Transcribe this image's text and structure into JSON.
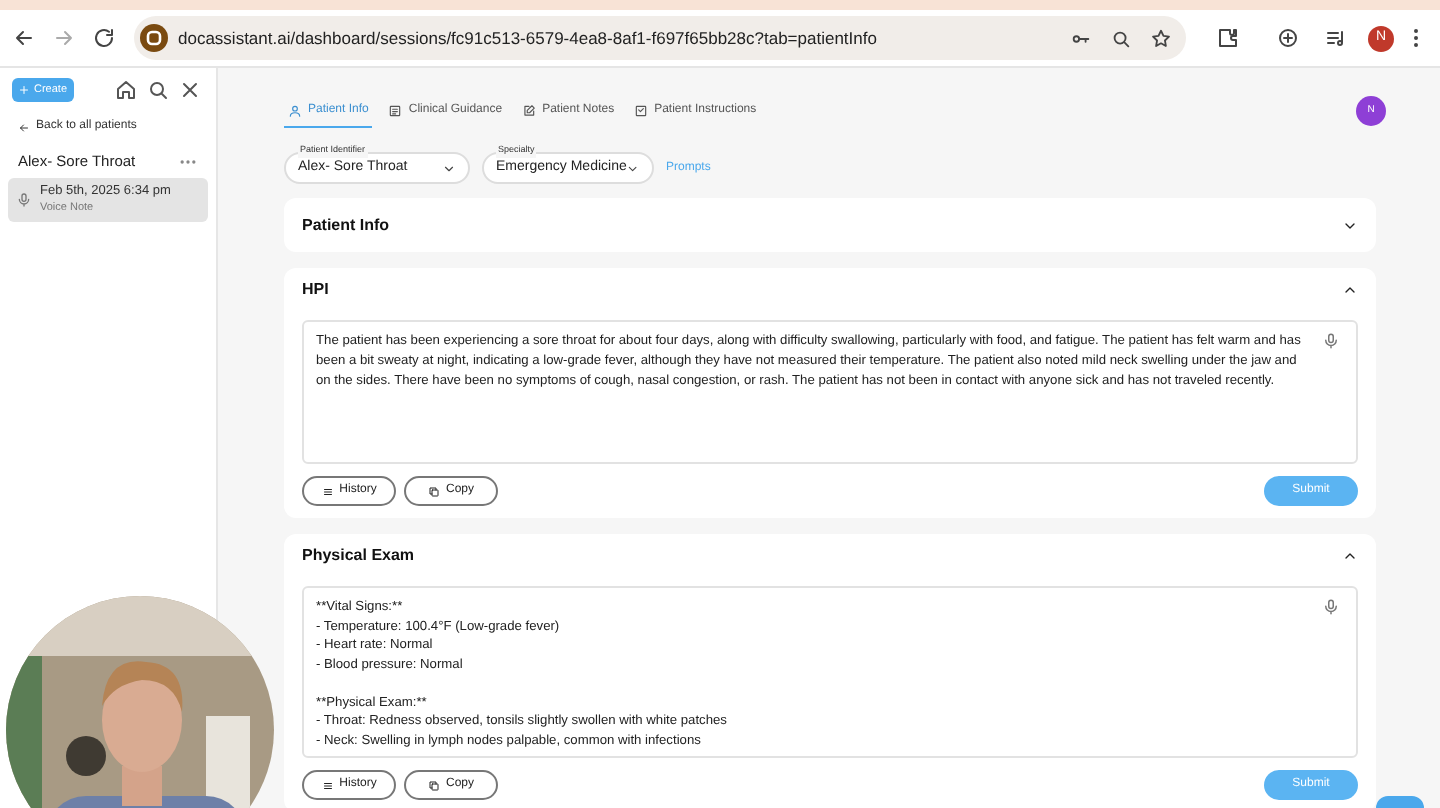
{
  "browser": {
    "url": "docassistant.ai/dashboard/sessions/fc91c513-6579-4ea8-8af1-f697f65bb28c?tab=patientInfo",
    "profile": "N"
  },
  "sidebar": {
    "create": "Create",
    "back": "Back to all patients",
    "patient": "Alex- Sore Throat",
    "sessions": [
      {
        "date": "Feb 5th, 2025 6:34 pm",
        "type": "Voice Note",
        "selected": true
      }
    ]
  },
  "tabs": [
    {
      "label": "Patient Info",
      "selected": true
    },
    {
      "label": "Clinical Guidance",
      "selected": false
    },
    {
      "label": "Patient Notes",
      "selected": false
    },
    {
      "label": "Patient Instructions",
      "selected": false
    }
  ],
  "user_avatar": "N",
  "fields": [
    {
      "label": "Patient Identifier",
      "value": "Alex- Sore Throat"
    },
    {
      "label": "Specialty",
      "value": "Emergency Medicine"
    }
  ],
  "prompts_link": "Prompts",
  "sections": [
    {
      "title": "Patient Info",
      "expanded": false
    },
    {
      "title": "HPI",
      "expanded": true,
      "text": "The patient has been experiencing a sore throat for about four days, along with difficulty swallowing, particularly with food, and fatigue. The patient has felt warm and has been a bit sweaty at night, indicating a low-grade fever, although they have not measured their temperature. The patient also noted mild neck swelling under the jaw and on the sides. There have been no symptoms of cough, nasal congestion, or rash. The patient has not been in contact with anyone sick and has not traveled recently.",
      "buttons": [
        "History",
        "Copy"
      ],
      "submit": "Submit"
    },
    {
      "title": "Physical Exam",
      "expanded": true,
      "text": "**Vital Signs:**\n- Temperature: 100.4°F (Low-grade fever)\n- Heart rate: Normal\n- Blood pressure: Normal\n\n**Physical Exam:**\n- Throat: Redness observed, tonsils slightly swollen with white patches\n- Neck: Swelling in lymph nodes palpable, common with infections",
      "buttons": [
        "History",
        "Copy"
      ],
      "submit": "Submit"
    }
  ]
}
